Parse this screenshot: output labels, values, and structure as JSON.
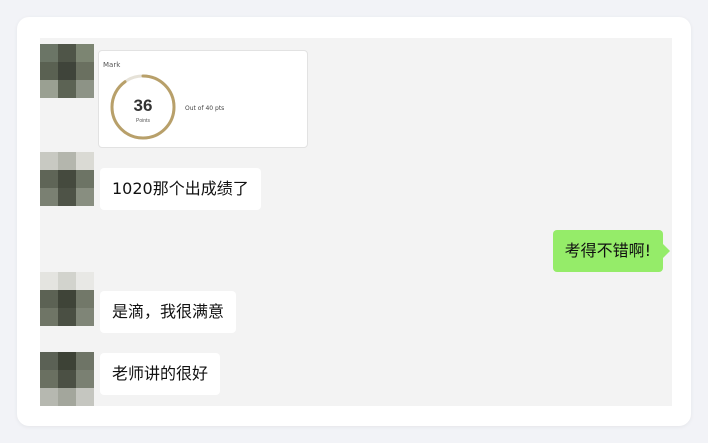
{
  "result_card": {
    "label": "Mark",
    "score": "36",
    "unit": "Points",
    "out_of": "Out of 40 pts",
    "progress": 0.9,
    "ring_color": "#b8a06a",
    "ring_track_color": "#e6e2d8"
  },
  "messages": [
    {
      "side": "left",
      "text": "1020那个出成绩了"
    },
    {
      "side": "right",
      "text": "考得不错啊!"
    },
    {
      "side": "left",
      "text": "是滴，我很满意"
    },
    {
      "side": "left",
      "text": "老师讲的很好"
    }
  ],
  "colors": {
    "chat_background": "#f3f3f3",
    "bubble_self": "#95ec69",
    "bubble_other": "#ffffff"
  }
}
